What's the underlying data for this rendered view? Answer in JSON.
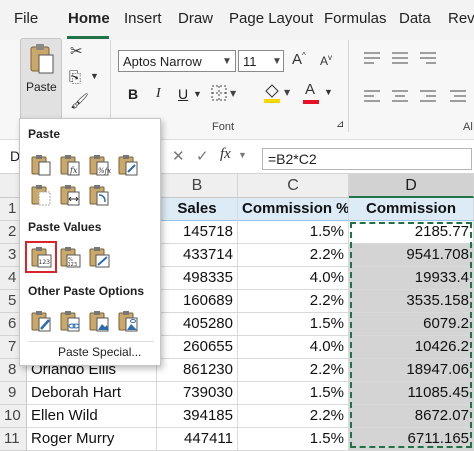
{
  "menubar": {
    "tabs": [
      {
        "label": "File",
        "active": false
      },
      {
        "label": "Home",
        "active": true
      },
      {
        "label": "Insert",
        "active": false
      },
      {
        "label": "Draw",
        "active": false
      },
      {
        "label": "Page Layout",
        "active": false
      },
      {
        "label": "Formulas",
        "active": false
      },
      {
        "label": "Data",
        "active": false
      },
      {
        "label": "Revi",
        "active": false
      }
    ]
  },
  "ribbon": {
    "paste_label": "Paste",
    "font_name": "Aptos Narrow",
    "font_size": "11",
    "font_group_label": "Font",
    "bold": "B",
    "italic": "I",
    "underline": "U",
    "font_color_glyph": "A",
    "grow_font_glyph": "A",
    "shrink_font_glyph": "A",
    "truncated_group_label": "Al",
    "accent_colors": {
      "highlight": "#ffd700",
      "font_color": "#e81123"
    }
  },
  "formula_bar": {
    "namebox_fragment": "D",
    "fx": "fx",
    "formula": "=B2*C2"
  },
  "paste_menu": {
    "heading_paste": "Paste",
    "heading_values": "Paste Values",
    "heading_other": "Other Paste Options",
    "paste_special": "Paste Special...",
    "paste_icons": [
      "paste-icon",
      "paste-formulas-icon",
      "paste-formulas-number-format-icon",
      "keep-source-formatting-icon",
      "no-borders-icon",
      "keep-column-widths-icon",
      "transpose-icon"
    ],
    "values_icons": [
      "paste-values-icon",
      "values-number-format-icon",
      "values-source-formatting-icon"
    ],
    "other_icons": [
      "formatting-icon",
      "paste-link-icon",
      "picture-icon",
      "linked-picture-icon"
    ],
    "highlighted": "paste-values-icon"
  },
  "sheet": {
    "columns": [
      "B",
      "C",
      "D"
    ],
    "selected_column": "D",
    "row_numbers": [
      "1",
      "2",
      "3",
      "4",
      "5",
      "6",
      "7",
      "8",
      "9",
      "10",
      "11"
    ],
    "headers": {
      "sales": "Sales",
      "commission_pct": "Commission %",
      "commission": "Commission"
    },
    "rows": [
      {
        "name": "",
        "sales": "145718",
        "pct": "1.5%",
        "commission": "2185.77"
      },
      {
        "name": "",
        "sales": "433714",
        "pct": "2.2%",
        "commission": "9541.708"
      },
      {
        "name": "",
        "sales": "498335",
        "pct": "4.0%",
        "commission": "19933.4"
      },
      {
        "name": "",
        "sales": "160689",
        "pct": "2.2%",
        "commission": "3535.158"
      },
      {
        "name": "",
        "sales": "405280",
        "pct": "1.5%",
        "commission": "6079.2"
      },
      {
        "name": "",
        "sales": "260655",
        "pct": "4.0%",
        "commission": "10426.2"
      },
      {
        "name": "Orlando Ellis",
        "sales": "861230",
        "pct": "2.2%",
        "commission": "18947.06"
      },
      {
        "name": "Deborah Hart",
        "sales": "739030",
        "pct": "1.5%",
        "commission": "11085.45"
      },
      {
        "name": "Ellen Wild",
        "sales": "394185",
        "pct": "2.2%",
        "commission": "8672.07"
      },
      {
        "name": "Roger Murry",
        "sales": "447411",
        "pct": "1.5%",
        "commission": "6711.165"
      }
    ],
    "colors": {
      "header_fill": "#ddebf7",
      "selection_fill": "#d4d4d4",
      "accent": "#217346"
    }
  }
}
